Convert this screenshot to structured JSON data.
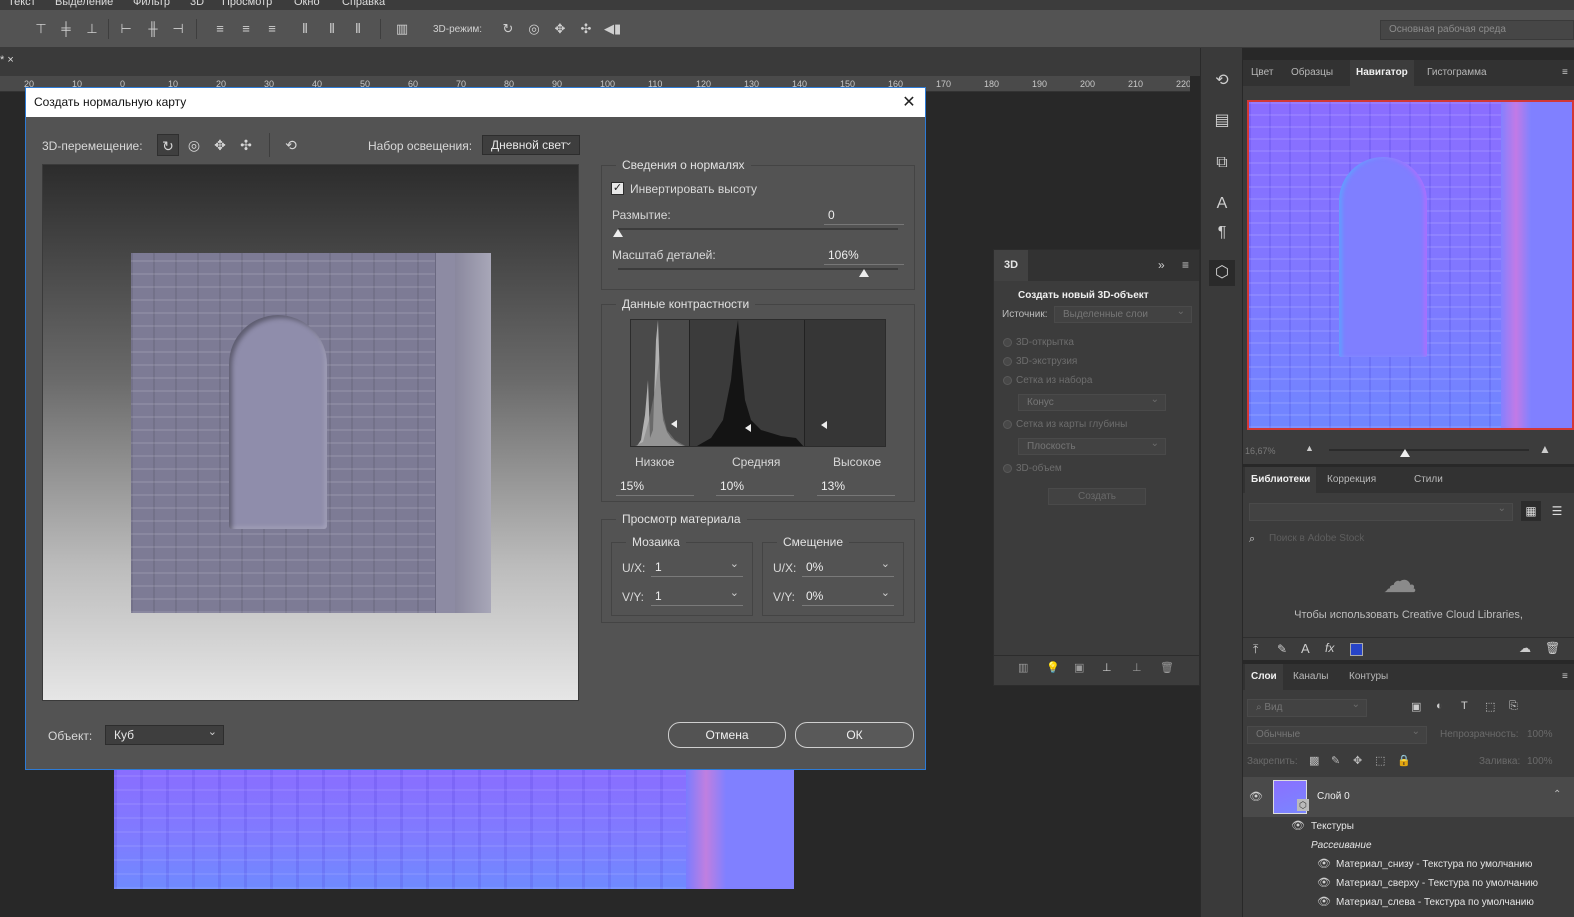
{
  "menu": {
    "items": [
      "Текст",
      "Выделение",
      "Фильтр",
      "3D",
      "Просмотр",
      "Окно",
      "Справка"
    ]
  },
  "options_bar": {
    "mode_label": "3D-режим:",
    "workspace": "Основная рабочая среда"
  },
  "document": {
    "tab_text": "* ×",
    "ruler_ticks": [
      "20",
      "10",
      "0",
      "10",
      "20",
      "30",
      "40",
      "50",
      "60",
      "70",
      "80",
      "90",
      "100",
      "110",
      "120",
      "130",
      "140",
      "150",
      "160",
      "170",
      "180",
      "190",
      "200",
      "210",
      "220"
    ]
  },
  "dialog": {
    "title": "Создать нормальную карту",
    "move_label": "3D-перемещение:",
    "lighting_label": "Набор освещения:",
    "lighting_value": "Дневной свет",
    "object_label": "Объект:",
    "object_value": "Куб",
    "normals": {
      "title": "Сведения о нормалях",
      "invert_label": "Инвертировать высоту",
      "invert_checked": true,
      "blur_label": "Размытие:",
      "blur_value": "0",
      "blur_fraction": 0.0,
      "detail_label": "Масштаб деталей:",
      "detail_value": "106%",
      "detail_fraction": 0.88
    },
    "contrast": {
      "title": "Данные контрастности",
      "low_label": "Низкое",
      "mid_label": "Средняя",
      "high_label": "Высокое",
      "low_value": "15%",
      "mid_value": "10%",
      "high_value": "13%"
    },
    "material": {
      "title": "Просмотр материала",
      "tile_title": "Мозаика",
      "offset_title": "Смещение",
      "ux_label": "U/X:",
      "vy_label": "V/Y:",
      "tile_ux": "1",
      "tile_vy": "1",
      "offset_ux": "0%",
      "offset_vy": "0%"
    },
    "cancel_label": "Отмена",
    "ok_label": "ОК"
  },
  "panel_3d": {
    "tab": "3D",
    "heading": "Создать новый 3D-объект",
    "source_label": "Источник:",
    "source_value": "Выделенные слои",
    "opt_postcard": "3D-открытка",
    "opt_extrude": "3D-экструзия",
    "opt_mesh_preset": "Сетка из набора",
    "preset_value": "Конус",
    "opt_depth": "Сетка из карты глубины",
    "depth_value": "Плоскость",
    "opt_volume": "3D-объем",
    "create_label": "Создать"
  },
  "navigator": {
    "tabs": [
      "Цвет",
      "Образцы",
      "Навигатор",
      "Гистограмма"
    ],
    "zoom": "16,67%"
  },
  "libraries": {
    "tabs": [
      "Библиотеки",
      "Коррекция",
      "Стили"
    ],
    "search_placeholder": "Поиск в Adobe Stock",
    "message": "Чтобы использовать Creative Cloud Libraries,"
  },
  "layers": {
    "tabs": [
      "Слои",
      "Каналы",
      "Контуры"
    ],
    "filter_label": "Вид",
    "blend_mode": "Обычные",
    "opacity_label": "Непрозрачность:",
    "opacity_value": "100%",
    "lock_label": "Закрепить:",
    "fill_label": "Заливка:",
    "fill_value": "100%",
    "layer_name": "Слой 0",
    "textures_label": "Текстуры",
    "diffuse_label": "Рассеивание",
    "materials": [
      "Материал_снизу - Текстура по умолчанию",
      "Материал_сверху - Текстура по умолчанию",
      "Материал_слева - Текстура по умолчанию"
    ]
  }
}
